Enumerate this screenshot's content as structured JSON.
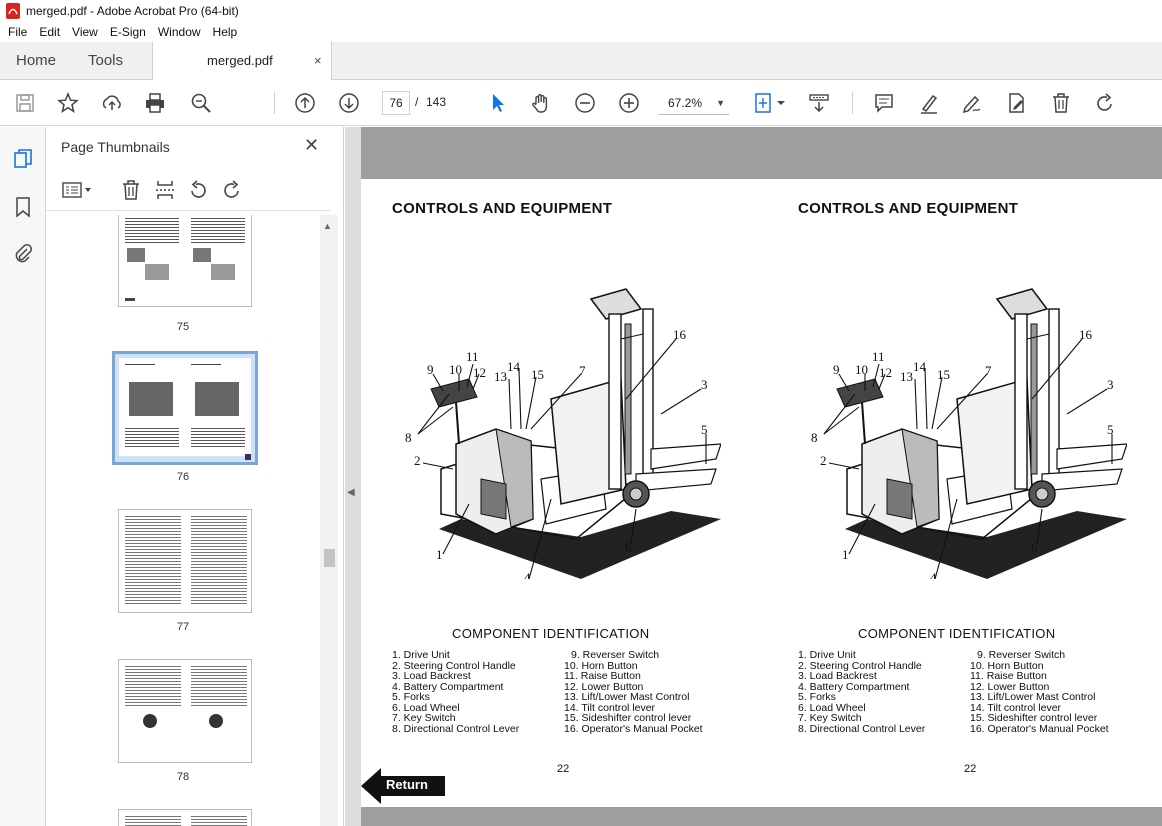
{
  "window": {
    "title": "merged.pdf - Adobe Acrobat Pro (64-bit)",
    "app_icon": "pdf-icon",
    "accent": "#d8261e"
  },
  "menu": [
    "File",
    "Edit",
    "View",
    "E-Sign",
    "Window",
    "Help"
  ],
  "tabs": {
    "home": "Home",
    "tools": "Tools",
    "document": "merged.pdf",
    "close": "×"
  },
  "toolbar": {
    "page_current": "76",
    "page_separator": "/",
    "page_total": "143",
    "zoom": "67.2%",
    "icons": [
      "save-icon",
      "star-icon",
      "upload-icon",
      "print-icon",
      "zoom-search-icon",
      "page-up-icon",
      "page-down-icon",
      "select-cursor-icon",
      "hand-icon",
      "zoom-out-icon",
      "zoom-in-icon",
      "fit-page-icon",
      "scroll-mode-icon",
      "comment-icon",
      "highlight-icon",
      "sign-icon",
      "edit-pdf-icon",
      "delete-icon",
      "rotate-icon"
    ]
  },
  "panel": {
    "title": "Page Thumbnails",
    "close": "✕",
    "thumbnails": [
      {
        "page": "75",
        "selected": false
      },
      {
        "page": "76",
        "selected": true
      },
      {
        "page": "77",
        "selected": false
      },
      {
        "page": "78",
        "selected": false
      }
    ]
  },
  "document": {
    "pages": [
      {
        "heading": "CONTROLS AND EQUIPMENT",
        "component_heading": "COMPONENT IDENTIFICATION",
        "page_number": "22",
        "left_list": [
          "1. Drive Unit",
          "2. Steering Control Handle",
          "3. Load Backrest",
          "4. Battery Compartment",
          "5. Forks",
          "6. Load Wheel",
          "7. Key Switch",
          "8. Directional Control Lever"
        ],
        "right_list": [
          "9. Reverser Switch",
          "10. Horn Button",
          "11. Raise Button",
          "12. Lower Button",
          "13. Lift/Lower Mast Control",
          "14. Tilt control lever",
          "15. Sideshifter control lever",
          "16. Operator's Manual Pocket"
        ]
      },
      {
        "heading": "CONTROLS AND EQUIPMENT",
        "component_heading": "COMPONENT IDENTIFICATION",
        "page_number": "22",
        "left_list": [
          "1. Drive Unit",
          "2. Steering Control Handle",
          "3. Load Backrest",
          "4. Battery Compartment",
          "5. Forks",
          "6. Load Wheel",
          "7. Key Switch",
          "8. Directional Control Lever"
        ],
        "right_list": [
          "9. Reverser Switch",
          "10. Horn Button",
          "11. Raise Button",
          "12. Lower Button",
          "13. Lift/Lower Mast Control",
          "14. Tilt control lever",
          "15. Sideshifter control lever",
          "16. Operator's Manual Pocket"
        ]
      }
    ],
    "callouts": [
      "1",
      "2",
      "3",
      "4",
      "5",
      "6",
      "7",
      "8",
      "9",
      "10",
      "11",
      "12",
      "13",
      "14",
      "15",
      "16"
    ],
    "return_label": "Return"
  }
}
